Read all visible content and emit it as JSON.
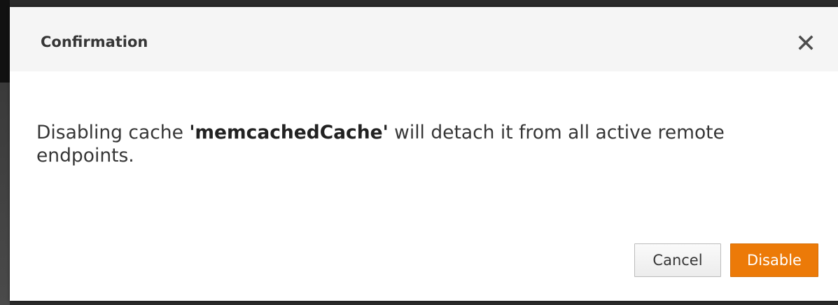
{
  "dialog": {
    "title": "Confirmation",
    "close_icon": "close-icon",
    "message": {
      "prefix": "Disabling cache ",
      "cache_name": "'memcachedCache'",
      "suffix": " will detach it from all active remote endpoints."
    },
    "buttons": {
      "cancel_label": "Cancel",
      "disable_label": "Disable"
    }
  },
  "colors": {
    "primary_button": "#ec7a08",
    "header_background": "#f5f5f5",
    "text": "#363636"
  }
}
